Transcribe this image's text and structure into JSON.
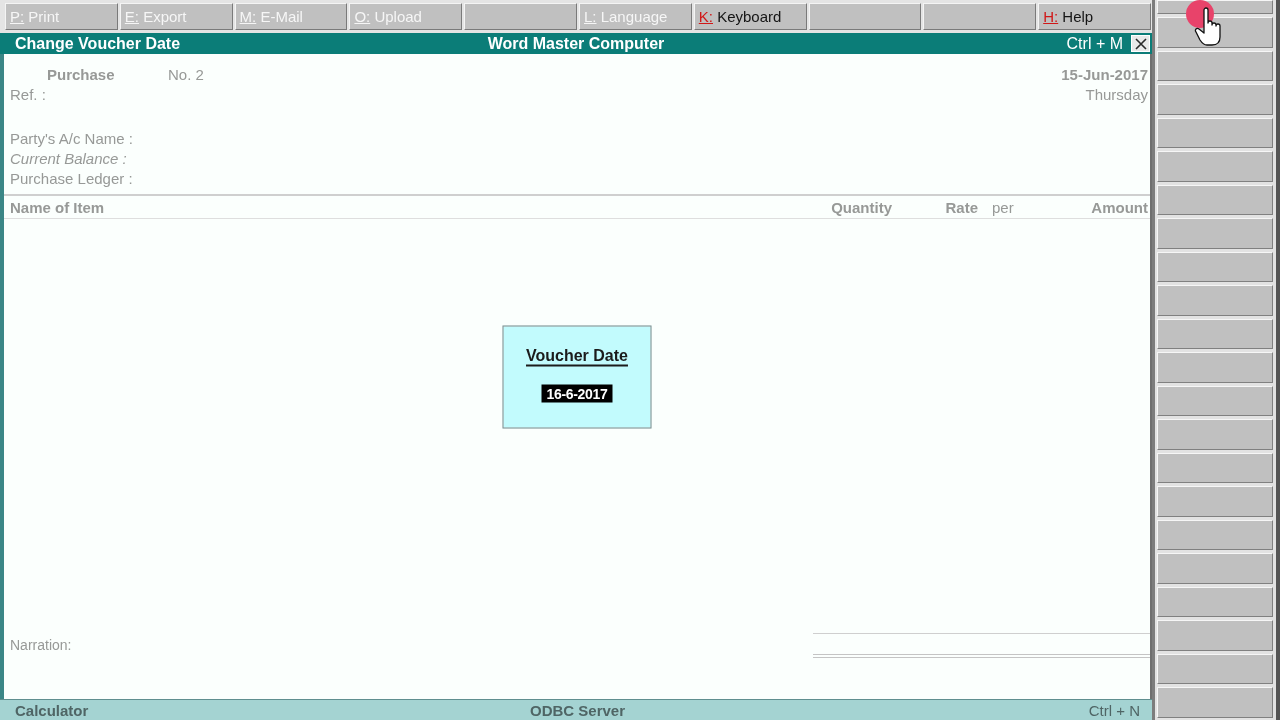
{
  "toolbar": [
    {
      "kind": "command",
      "key": "P:",
      "label": "Print",
      "disabled": true
    },
    {
      "kind": "command",
      "key": "E:",
      "label": "Export",
      "disabled": true
    },
    {
      "kind": "command",
      "key": "M:",
      "label": "E-Mail",
      "disabled": true
    },
    {
      "kind": "command",
      "key": "O:",
      "label": "Upload",
      "disabled": true
    },
    {
      "kind": "blank"
    },
    {
      "kind": "command",
      "key": "L:",
      "label": "Language",
      "disabled": true
    },
    {
      "kind": "command",
      "key": "K:",
      "label": "Keyboard",
      "disabled": false
    },
    {
      "kind": "blank"
    },
    {
      "kind": "blank"
    },
    {
      "kind": "command",
      "key": "H:",
      "label": "Help",
      "disabled": false
    }
  ],
  "title_bar": {
    "title": "Change Voucher Date",
    "company": "Word Master Computer",
    "shortcut": "Ctrl + M"
  },
  "voucher": {
    "disabled": true,
    "type": "Purchase",
    "number": "No. 2",
    "ref": "Ref. :",
    "date": "15-Jun-2017",
    "weekday": "Thursday",
    "fields": [
      {
        "kind": "ledger",
        "label": "Party's A/c Name :"
      },
      {
        "kind": "balance",
        "label": "Current Balance :"
      },
      {
        "kind": "ledger",
        "label": "Purchase Ledger :"
      }
    ],
    "columns": [
      {
        "kind": "item",
        "label": "Name of Item"
      },
      {
        "kind": "number",
        "label": "Quantity"
      },
      {
        "kind": "number",
        "label": "Rate"
      },
      {
        "kind": "unit",
        "label": "per"
      },
      {
        "kind": "number",
        "label": "Amount"
      }
    ],
    "narration": "Narration:"
  },
  "dialog": {
    "title": "Voucher Date",
    "value": "16-6-2017"
  },
  "status_bar": {
    "left": "Calculator",
    "center": "ODBC Server",
    "right": "Ctrl + N"
  }
}
